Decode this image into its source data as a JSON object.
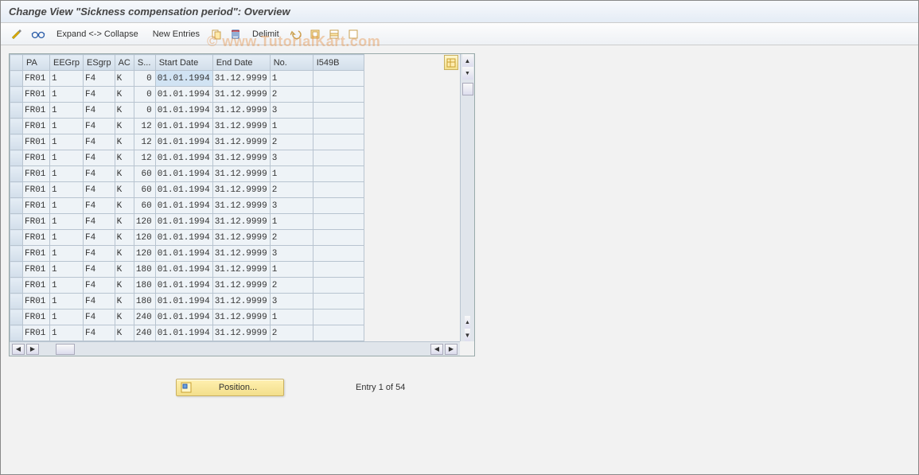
{
  "title": "Change View \"Sickness compensation period\": Overview",
  "watermark": "© www.TutorialKart.com",
  "toolbar": {
    "expand_collapse": "Expand <-> Collapse",
    "new_entries": "New Entries",
    "delimit": "Delimit"
  },
  "table": {
    "columns": [
      "PA",
      "EEGrp",
      "ESgrp",
      "AC",
      "S...",
      "Start Date",
      "End Date",
      "No.",
      "I549B"
    ],
    "rows": [
      {
        "pa": "FR01",
        "eegrp": "1",
        "esgrp": "F4",
        "ac": "K",
        "s": "0",
        "start": "01.01.1994",
        "end": "31.12.9999",
        "no": "1",
        "i549b": ""
      },
      {
        "pa": "FR01",
        "eegrp": "1",
        "esgrp": "F4",
        "ac": "K",
        "s": "0",
        "start": "01.01.1994",
        "end": "31.12.9999",
        "no": "2",
        "i549b": ""
      },
      {
        "pa": "FR01",
        "eegrp": "1",
        "esgrp": "F4",
        "ac": "K",
        "s": "0",
        "start": "01.01.1994",
        "end": "31.12.9999",
        "no": "3",
        "i549b": ""
      },
      {
        "pa": "FR01",
        "eegrp": "1",
        "esgrp": "F4",
        "ac": "K",
        "s": "12",
        "start": "01.01.1994",
        "end": "31.12.9999",
        "no": "1",
        "i549b": ""
      },
      {
        "pa": "FR01",
        "eegrp": "1",
        "esgrp": "F4",
        "ac": "K",
        "s": "12",
        "start": "01.01.1994",
        "end": "31.12.9999",
        "no": "2",
        "i549b": ""
      },
      {
        "pa": "FR01",
        "eegrp": "1",
        "esgrp": "F4",
        "ac": "K",
        "s": "12",
        "start": "01.01.1994",
        "end": "31.12.9999",
        "no": "3",
        "i549b": ""
      },
      {
        "pa": "FR01",
        "eegrp": "1",
        "esgrp": "F4",
        "ac": "K",
        "s": "60",
        "start": "01.01.1994",
        "end": "31.12.9999",
        "no": "1",
        "i549b": ""
      },
      {
        "pa": "FR01",
        "eegrp": "1",
        "esgrp": "F4",
        "ac": "K",
        "s": "60",
        "start": "01.01.1994",
        "end": "31.12.9999",
        "no": "2",
        "i549b": ""
      },
      {
        "pa": "FR01",
        "eegrp": "1",
        "esgrp": "F4",
        "ac": "K",
        "s": "60",
        "start": "01.01.1994",
        "end": "31.12.9999",
        "no": "3",
        "i549b": ""
      },
      {
        "pa": "FR01",
        "eegrp": "1",
        "esgrp": "F4",
        "ac": "K",
        "s": "120",
        "start": "01.01.1994",
        "end": "31.12.9999",
        "no": "1",
        "i549b": ""
      },
      {
        "pa": "FR01",
        "eegrp": "1",
        "esgrp": "F4",
        "ac": "K",
        "s": "120",
        "start": "01.01.1994",
        "end": "31.12.9999",
        "no": "2",
        "i549b": ""
      },
      {
        "pa": "FR01",
        "eegrp": "1",
        "esgrp": "F4",
        "ac": "K",
        "s": "120",
        "start": "01.01.1994",
        "end": "31.12.9999",
        "no": "3",
        "i549b": ""
      },
      {
        "pa": "FR01",
        "eegrp": "1",
        "esgrp": "F4",
        "ac": "K",
        "s": "180",
        "start": "01.01.1994",
        "end": "31.12.9999",
        "no": "1",
        "i549b": ""
      },
      {
        "pa": "FR01",
        "eegrp": "1",
        "esgrp": "F4",
        "ac": "K",
        "s": "180",
        "start": "01.01.1994",
        "end": "31.12.9999",
        "no": "2",
        "i549b": ""
      },
      {
        "pa": "FR01",
        "eegrp": "1",
        "esgrp": "F4",
        "ac": "K",
        "s": "180",
        "start": "01.01.1994",
        "end": "31.12.9999",
        "no": "3",
        "i549b": ""
      },
      {
        "pa": "FR01",
        "eegrp": "1",
        "esgrp": "F4",
        "ac": "K",
        "s": "240",
        "start": "01.01.1994",
        "end": "31.12.9999",
        "no": "1",
        "i549b": ""
      },
      {
        "pa": "FR01",
        "eegrp": "1",
        "esgrp": "F4",
        "ac": "K",
        "s": "240",
        "start": "01.01.1994",
        "end": "31.12.9999",
        "no": "2",
        "i549b": ""
      }
    ],
    "selected_cell": {
      "row": 0,
      "col": "start"
    }
  },
  "footer": {
    "position_label": "Position...",
    "entry_text": "Entry 1 of 54"
  }
}
